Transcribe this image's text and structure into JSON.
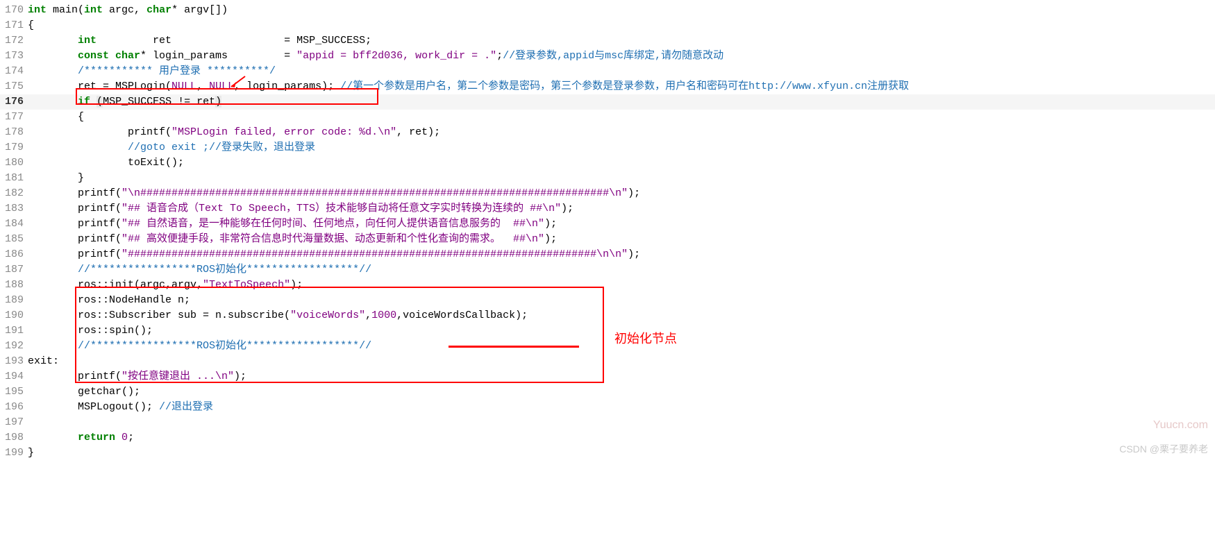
{
  "lines": [
    {
      "num": "170",
      "segs": [
        {
          "cls": "type",
          "t": "int"
        },
        {
          "t": " main("
        },
        {
          "cls": "type",
          "t": "int"
        },
        {
          "t": " argc, "
        },
        {
          "cls": "type",
          "t": "char"
        },
        {
          "t": "* argv[])"
        }
      ]
    },
    {
      "num": "171",
      "segs": [
        {
          "t": "{"
        }
      ]
    },
    {
      "num": "172",
      "segs": [
        {
          "t": "        "
        },
        {
          "cls": "type",
          "t": "int"
        },
        {
          "t": "         ret                  = MSP_SUCCESS;"
        }
      ]
    },
    {
      "num": "173",
      "segs": [
        {
          "t": "        "
        },
        {
          "cls": "type",
          "t": "const char"
        },
        {
          "t": "* login_params         = "
        },
        {
          "cls": "strpurple",
          "t": "\"appid = bff2d036, work_dir = .\""
        },
        {
          "t": ";"
        },
        {
          "cls": "comment",
          "t": "//登录参数,appid与msc库绑定,请勿随意改动"
        }
      ]
    },
    {
      "num": "174",
      "segs": [
        {
          "t": "        "
        },
        {
          "cls": "comment",
          "t": "/*********** 用户登录 **********/"
        }
      ]
    },
    {
      "num": "175",
      "segs": [
        {
          "t": "        ret = MSPLogin("
        },
        {
          "cls": "nullkw",
          "t": "NULL"
        },
        {
          "t": ", "
        },
        {
          "cls": "nullkw",
          "t": "NULL"
        },
        {
          "t": ", login_params); "
        },
        {
          "cls": "comment",
          "t": "//第一个参数是用户名，第二个参数是密码，第三个参数是登录参数，用户名和密码可在http://www.xfyun.cn注册获取"
        }
      ]
    },
    {
      "num": "176",
      "hl": true,
      "segs": [
        {
          "t": "        "
        },
        {
          "cls": "kw",
          "t": "if"
        },
        {
          "t": " "
        },
        {
          "cls": "paren-hl",
          "t": "("
        },
        {
          "t": "MSP_SUCCESS != ret"
        },
        {
          "cls": "paren-hl",
          "t": ")"
        }
      ]
    },
    {
      "num": "177",
      "segs": [
        {
          "t": "        {"
        }
      ]
    },
    {
      "num": "178",
      "segs": [
        {
          "t": "                printf("
        },
        {
          "cls": "strpurple",
          "t": "\"MSPLogin failed, error code: %d.\\n\""
        },
        {
          "t": ", ret);"
        }
      ]
    },
    {
      "num": "179",
      "segs": [
        {
          "t": "                "
        },
        {
          "cls": "comment",
          "t": "//goto exit ;//登录失败，退出登录"
        }
      ]
    },
    {
      "num": "180",
      "segs": [
        {
          "t": "                toExit();"
        }
      ]
    },
    {
      "num": "181",
      "segs": [
        {
          "t": "        }"
        }
      ]
    },
    {
      "num": "182",
      "segs": [
        {
          "t": "        printf("
        },
        {
          "cls": "strpurple",
          "t": "\"\\n###########################################################################\\n\""
        },
        {
          "t": ");"
        }
      ]
    },
    {
      "num": "183",
      "segs": [
        {
          "t": "        printf("
        },
        {
          "cls": "strpurple",
          "t": "\"## 语音合成（Text To Speech，TTS）技术能够自动将任意文字实时转换为连续的 ##\\n\""
        },
        {
          "t": ");"
        }
      ]
    },
    {
      "num": "184",
      "segs": [
        {
          "t": "        printf("
        },
        {
          "cls": "strpurple",
          "t": "\"## 自然语音，是一种能够在任何时间、任何地点，向任何人提供语音信息服务的  ##\\n\""
        },
        {
          "t": ");"
        }
      ]
    },
    {
      "num": "185",
      "segs": [
        {
          "t": "        printf("
        },
        {
          "cls": "strpurple",
          "t": "\"## 高效便捷手段，非常符合信息时代海量数据、动态更新和个性化查询的需求。  ##\\n\""
        },
        {
          "t": ");"
        }
      ]
    },
    {
      "num": "186",
      "segs": [
        {
          "t": "        printf("
        },
        {
          "cls": "strpurple",
          "t": "\"###########################################################################\\n\\n\""
        },
        {
          "t": ");"
        }
      ]
    },
    {
      "num": "187",
      "segs": [
        {
          "t": "        "
        },
        {
          "cls": "comment",
          "t": "//*****************ROS初始化******************//"
        }
      ]
    },
    {
      "num": "188",
      "segs": [
        {
          "t": "        ros::init(argc,argv,"
        },
        {
          "cls": "strpurple",
          "t": "\"TextToSpeech\""
        },
        {
          "t": ");"
        }
      ]
    },
    {
      "num": "189",
      "segs": [
        {
          "t": "        ros::NodeHandle n;"
        }
      ]
    },
    {
      "num": "190",
      "segs": [
        {
          "t": "        ros::Subscriber sub = n.subscribe("
        },
        {
          "cls": "strpurple",
          "t": "\"voiceWords\""
        },
        {
          "t": ","
        },
        {
          "cls": "num",
          "t": "1000"
        },
        {
          "t": ",voiceWordsCallback);"
        }
      ]
    },
    {
      "num": "191",
      "segs": [
        {
          "t": "        ros::spin();"
        }
      ]
    },
    {
      "num": "192",
      "segs": [
        {
          "t": "        "
        },
        {
          "cls": "comment",
          "t": "//*****************ROS初始化******************//"
        }
      ]
    },
    {
      "num": "193",
      "segs": [
        {
          "t": "exit:"
        }
      ]
    },
    {
      "num": "194",
      "segs": [
        {
          "t": "        printf("
        },
        {
          "cls": "strpurple",
          "t": "\"按任意键退出 ...\\n\""
        },
        {
          "t": ");"
        }
      ]
    },
    {
      "num": "195",
      "segs": [
        {
          "t": "        getchar();"
        }
      ]
    },
    {
      "num": "196",
      "segs": [
        {
          "t": "        MSPLogout(); "
        },
        {
          "cls": "comment",
          "t": "//退出登录"
        }
      ]
    },
    {
      "num": "197",
      "segs": [
        {
          "t": ""
        }
      ]
    },
    {
      "num": "198",
      "segs": [
        {
          "t": "        "
        },
        {
          "cls": "kw",
          "t": "return"
        },
        {
          "t": " "
        },
        {
          "cls": "num",
          "t": "0"
        },
        {
          "t": ";"
        }
      ]
    },
    {
      "num": "199",
      "segs": [
        {
          "t": "}"
        }
      ]
    }
  ],
  "annotations": {
    "label": "初始化节点"
  },
  "watermarks": {
    "w1": "Yuucn.com",
    "w2": "CSDN @栗子要养老"
  }
}
